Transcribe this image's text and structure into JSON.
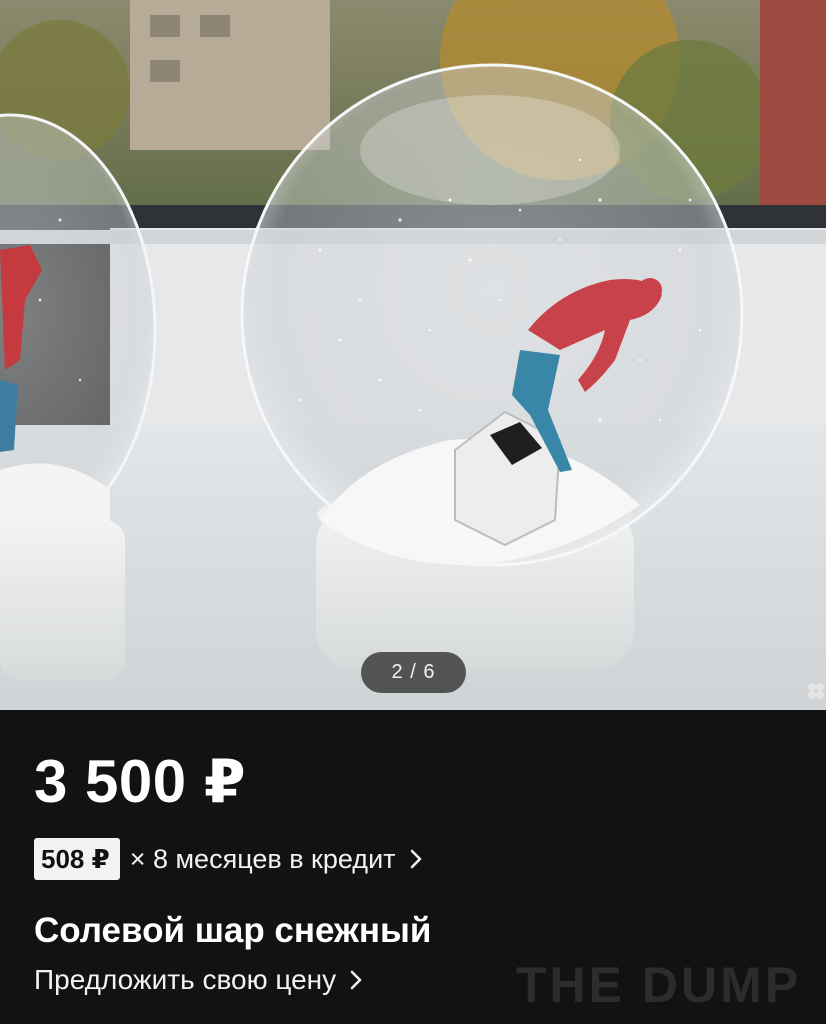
{
  "gallery": {
    "counter": "2 / 6",
    "image_description_icon": "snow-globe-photo"
  },
  "listing": {
    "price": "3 500 ₽",
    "credit_amount": "508 ₽",
    "credit_text": "× 8 месяцев в кредит",
    "title": "Солевой шар снежный",
    "offer_label": "Предложить свою цену"
  },
  "watermark": "THE DUMP",
  "colors": {
    "background": "#121212",
    "text": "#ffffff",
    "badge_bg": "#f3f3f3",
    "badge_text": "#111111"
  }
}
